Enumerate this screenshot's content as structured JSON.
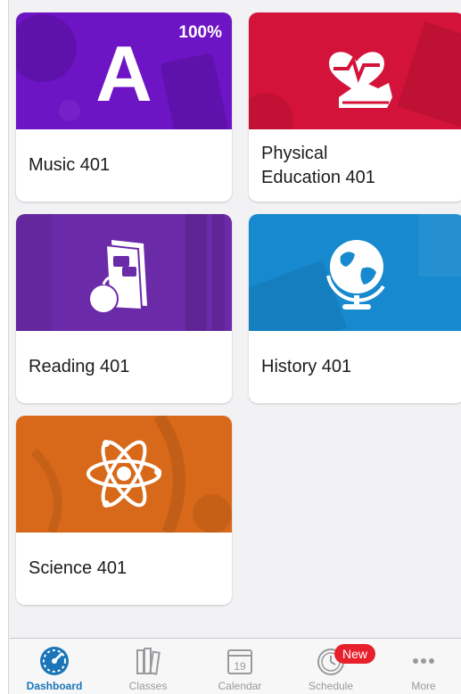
{
  "courses": [
    {
      "title": "Music 401",
      "progress": "100%",
      "icon": "letter-a-icon",
      "letter": "A",
      "color": "#6d14c4"
    },
    {
      "title": "Physical\nEducation 401",
      "icon": "heart-shoe-icon",
      "color": "#d4133a"
    },
    {
      "title": "Reading 401",
      "icon": "book-apple-icon",
      "color": "#6b2aa8"
    },
    {
      "title": "History 401",
      "icon": "globe-icon",
      "color": "#1789cf"
    },
    {
      "title": "Science  401",
      "icon": "atom-icon",
      "color": "#d8691a"
    }
  ],
  "tabbar": {
    "active": "Dashboard",
    "accent": "#1a76b8",
    "items": [
      {
        "label": "Dashboard",
        "icon": "speedometer-icon"
      },
      {
        "label": "Classes",
        "icon": "books-icon"
      },
      {
        "label": "Calendar",
        "icon": "calendar-icon",
        "day": "19"
      },
      {
        "label": "Schedule",
        "icon": "clock-icon",
        "badge": "New"
      },
      {
        "label": "More",
        "icon": "more-dots-icon"
      }
    ]
  }
}
